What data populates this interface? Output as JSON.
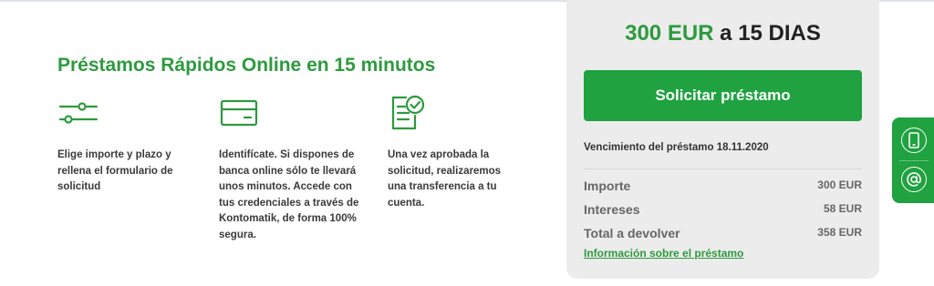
{
  "main": {
    "title": "Préstamos Rápidos Online en 15 minutos",
    "steps": [
      {
        "icon": "sliders-icon",
        "text": "Elige importe y plazo y rellena el formulario de solicitud"
      },
      {
        "icon": "credit-card-icon",
        "text": "Identifícate. Si dispones de banca online sólo te llevará unos minutos. Accede con tus credenciales a través de Kontomatik, de forma 100% segura."
      },
      {
        "icon": "document-check-icon",
        "text": "Una vez aprobada la solicitud, realizaremos una transferencia a tu cuenta."
      }
    ]
  },
  "panel": {
    "offer_amount": "300 EUR",
    "offer_rest": "a 15 DIAS",
    "cta_label": "Solicitar préstamo",
    "due_label": "Vencimiento del préstamo 18.11.2020",
    "rows": [
      {
        "label": "Importe",
        "value": "300 EUR"
      },
      {
        "label": "Intereses",
        "value": "58 EUR"
      },
      {
        "label": "Total a devolver",
        "value": "358 EUR"
      }
    ],
    "info_link": "Información sobre el préstamo"
  },
  "side_tab": {
    "icons": [
      "phone-icon",
      "at-sign-icon"
    ]
  },
  "colors": {
    "accent": "#1fa23f",
    "title_green": "#2d9a3e",
    "panel_bg": "#ececec"
  }
}
